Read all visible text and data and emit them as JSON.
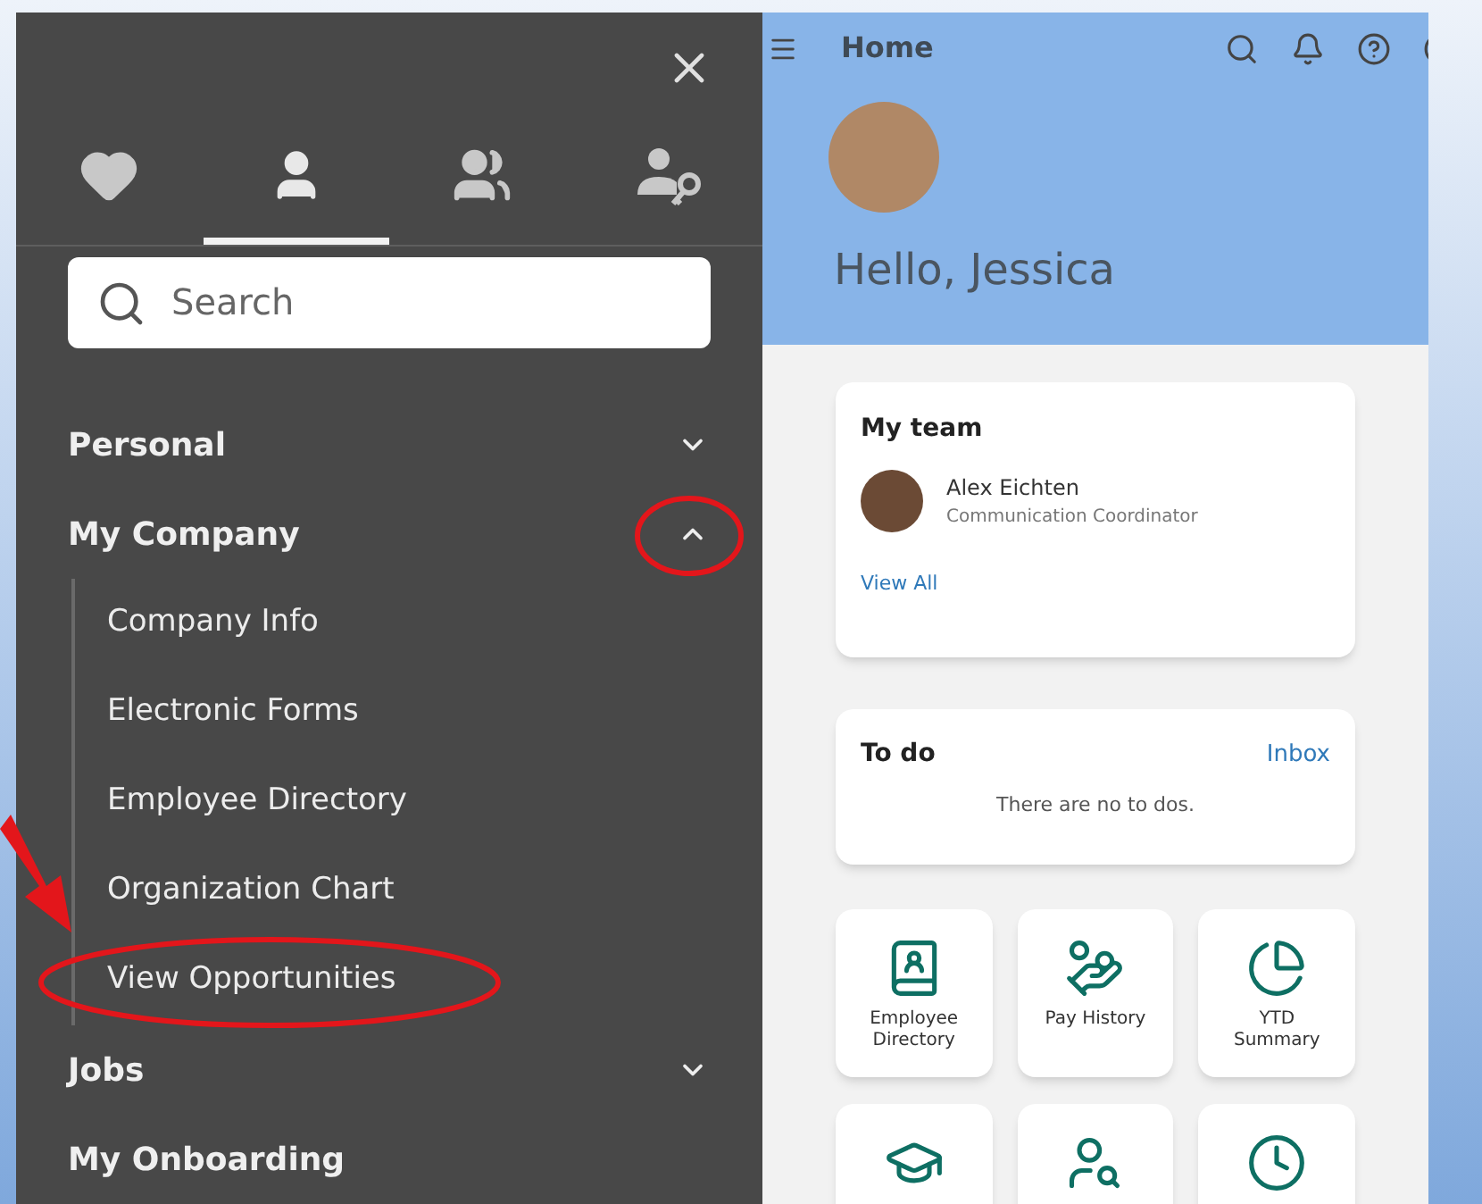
{
  "drawer": {
    "tabs": [
      {
        "kind": "favorites",
        "selected": false
      },
      {
        "kind": "person",
        "selected": true
      },
      {
        "kind": "team",
        "selected": false
      },
      {
        "kind": "admin",
        "selected": false
      }
    ],
    "search": {
      "placeholder": "Search"
    },
    "nav": [
      {
        "label": "Personal",
        "expanded": false
      },
      {
        "label": "My Company",
        "expanded": true,
        "circled": true,
        "children": [
          {
            "label": "Company Info",
            "circled": false
          },
          {
            "label": "Electronic Forms",
            "circled": false
          },
          {
            "label": "Employee Directory",
            "circled": false
          },
          {
            "label": "Organization Chart",
            "circled": false
          },
          {
            "label": "View Opportunities",
            "circled": true
          }
        ]
      },
      {
        "label": "Jobs",
        "expanded": false
      },
      {
        "label": "My Onboarding"
      }
    ]
  },
  "home": {
    "title": "Home",
    "greeting": "Hello, Jessica",
    "my_team": {
      "title": "My team",
      "members": [
        {
          "name": "Alex Eichten",
          "role": "Communication Coordinator"
        }
      ],
      "link": "View All"
    },
    "todo": {
      "title": "To do",
      "link": "Inbox",
      "empty": "There are no to dos."
    },
    "tiles": [
      {
        "kind": "directory",
        "label": "Employee Directory"
      },
      {
        "kind": "pay",
        "label": "Pay History"
      },
      {
        "kind": "ytd",
        "label": "YTD Summary"
      },
      {
        "kind": "graduate"
      },
      {
        "kind": "people-search"
      },
      {
        "kind": "clock-person"
      }
    ]
  }
}
